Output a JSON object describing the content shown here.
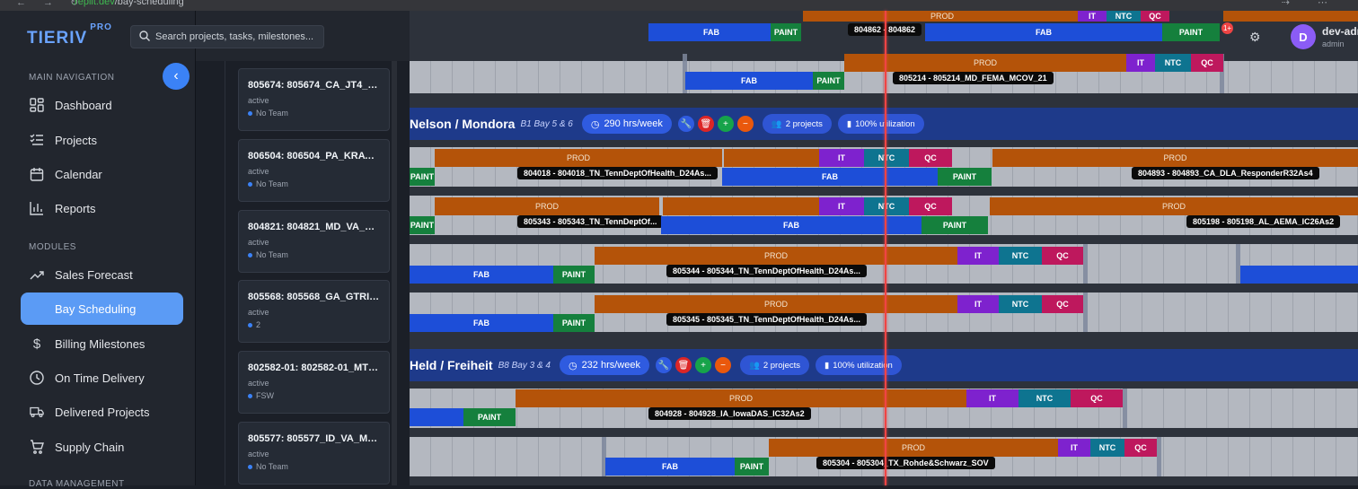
{
  "browser": {
    "url_host": ".replit.dev",
    "url_path": "/bay-scheduling"
  },
  "brand": {
    "name": "TIERIV",
    "tag": "PRO"
  },
  "search": {
    "placeholder": "Search projects, tasks, milestones..."
  },
  "sidebar": {
    "main_heading": "MAIN NAVIGATION",
    "modules_heading": "MODULES",
    "data_heading": "DATA MANAGEMENT",
    "main_items": [
      {
        "label": "Dashboard",
        "icon": "dashboard-icon"
      },
      {
        "label": "Projects",
        "icon": "checklist-icon"
      },
      {
        "label": "Calendar",
        "icon": "calendar-icon"
      },
      {
        "label": "Reports",
        "icon": "bar-chart-icon"
      }
    ],
    "module_items": [
      {
        "label": "Sales Forecast",
        "icon": "trend-icon"
      },
      {
        "label": "Bay Scheduling",
        "icon": "",
        "active": true
      },
      {
        "label": "Billing Milestones",
        "icon": "dollar-icon"
      },
      {
        "label": "On Time Delivery",
        "icon": "clock-icon"
      },
      {
        "label": "Delivered Projects",
        "icon": "truck-icon"
      },
      {
        "label": "Supply Chain",
        "icon": "cart-icon"
      }
    ]
  },
  "project_cards": [
    {
      "title": "805674: 805674_CA_JT4_IC...",
      "status": "active",
      "team": "No Team"
    },
    {
      "title": "806504: 806504_PA_KRATO...",
      "status": "active",
      "team": "No Team"
    },
    {
      "title": "804821: 804821_MD_VA_M...",
      "status": "active",
      "team": "No Team"
    },
    {
      "title": "805568: 805568_GA_GTRI_...",
      "status": "active",
      "team": "2"
    },
    {
      "title": "802582-01: 802582-01_MT_...",
      "status": "active",
      "team": "FSW"
    },
    {
      "title": "805577: 805577_ID_VA_Mo...",
      "status": "active",
      "team": "No Team"
    }
  ],
  "user": {
    "initial": "D",
    "name": "dev-adm",
    "role": "admin",
    "notifications": "1+"
  },
  "phase_labels": {
    "fab": "FAB",
    "paint": "PAINT",
    "prod": "PROD",
    "it": "IT",
    "ntc": "NTC",
    "qc": "QC"
  },
  "teams": [
    {
      "name": "Nelson / Mondora",
      "bays": "B1 Bay 5 & 6",
      "hours": "290 hrs/week",
      "projects": "2 projects",
      "utilization": "100% utilization"
    },
    {
      "name": "Held / Freiheit",
      "bays": "B8 Bay 3 & 4",
      "hours": "232 hrs/week",
      "projects": "2 projects",
      "utilization": "100% utilization"
    }
  ],
  "project_labels": {
    "p804862": "804862 - 804862",
    "p805214": "805214 - 805214_MD_FEMA_MCOV_21",
    "p804018": "804018 - 804018_TN_TennDeptOfHealth_D24As...",
    "p804893": "804893 - 804893_CA_DLA_ResponderR32As4",
    "p805343": "805343 - 805343_TN_TennDeptOf...",
    "p805198": "805198 - 805198_AL_AEMA_IC26As2",
    "p805344": "805344 - 805344_TN_TennDeptOfHealth_D24As...",
    "p805345": "805345 - 805345_TN_TennDeptOfHealth_D24As...",
    "p804928": "804928 - 804928_IA_IowaDAS_IC32As2",
    "p805304": "805304 - 805304_TX_Rohde&Schwarz_SOV"
  }
}
